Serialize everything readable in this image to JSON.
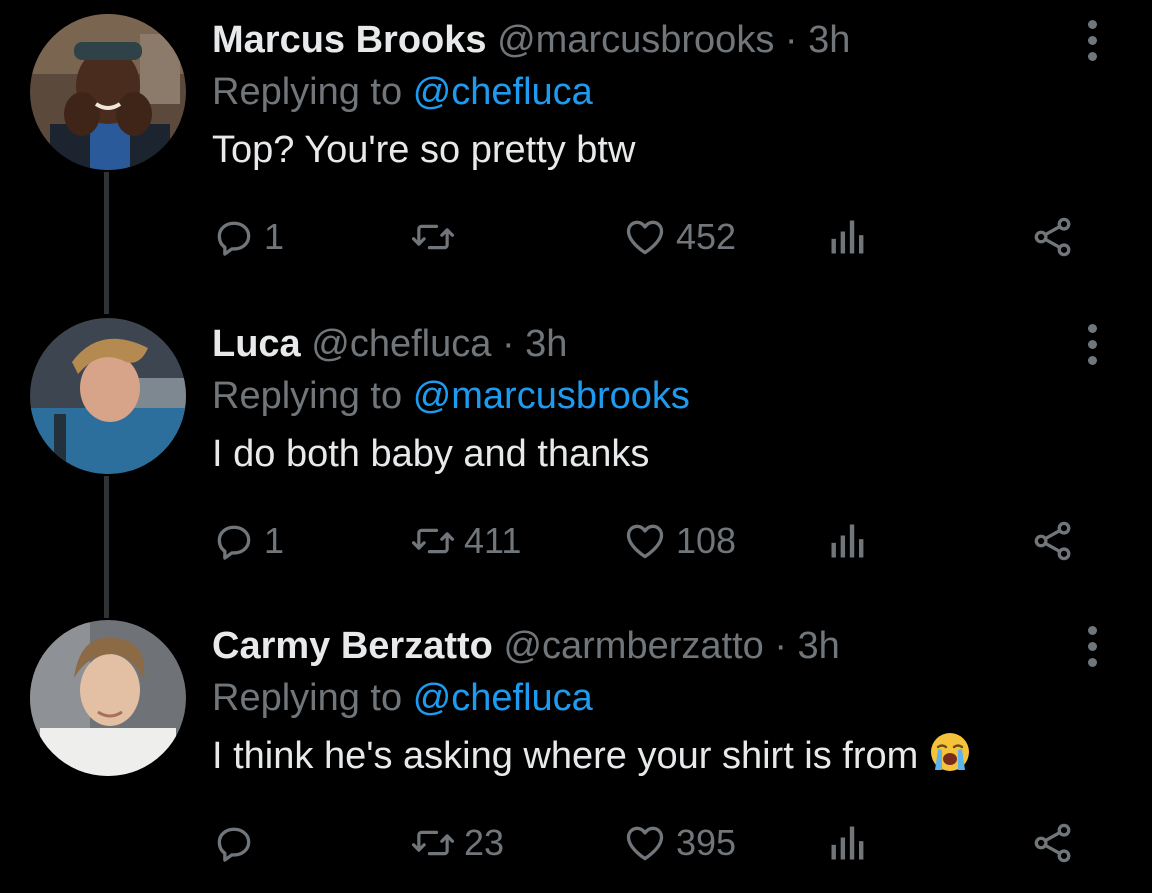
{
  "tweets": [
    {
      "name": "Marcus Brooks",
      "handle": "@marcusbrooks",
      "separator": "·",
      "time": "3h",
      "replying_prefix": "Replying to",
      "replying_to": "@chefluca",
      "text": "Top? You're so pretty btw",
      "emoji": "",
      "replies": "1",
      "retweets": "",
      "likes": "452"
    },
    {
      "name": "Luca",
      "handle": "@chefluca",
      "separator": "·",
      "time": "3h",
      "replying_prefix": "Replying to",
      "replying_to": "@marcusbrooks",
      "text": "I do both baby and thanks",
      "emoji": "",
      "replies": "1",
      "retweets": "411",
      "likes": "108"
    },
    {
      "name": "Carmy Berzatto",
      "handle": "@carmberzatto",
      "separator": "·",
      "time": "3h",
      "replying_prefix": "Replying to",
      "replying_to": "@chefluca",
      "text": "I think he's asking where your shirt is from",
      "emoji": "loudly-crying-face",
      "replies": "",
      "retweets": "23",
      "likes": "395"
    }
  ],
  "icons": {
    "reply": "speech-bubble-icon",
    "retweet": "retweet-arrows-icon",
    "like": "heart-outline-icon",
    "views": "bar-chart-icon",
    "share": "share-nodes-icon",
    "more": "vertical-ellipsis-icon"
  },
  "colors": {
    "background": "#000000",
    "primary_text": "#e7e9ea",
    "secondary_text": "#71767b",
    "accent": "#1d9bf0",
    "thread_line": "#2f3336"
  }
}
